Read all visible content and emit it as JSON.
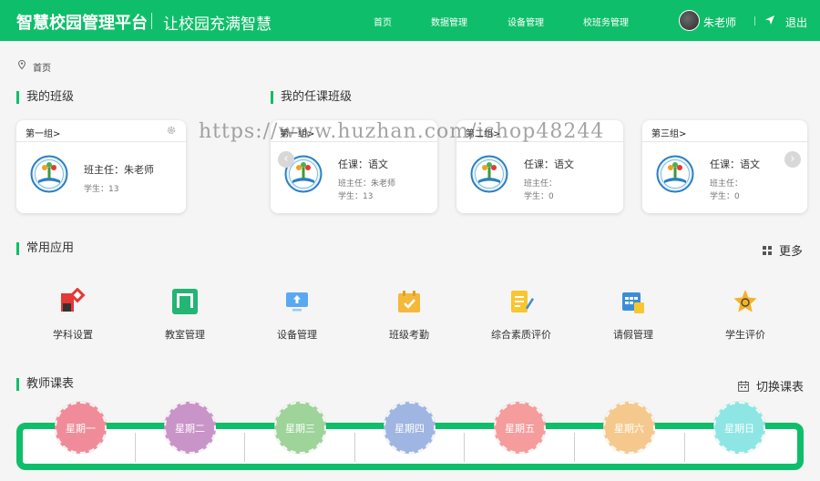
{
  "header": {
    "title": "智慧校园管理平台",
    "subtitle": "让校园充满智慧",
    "nav": [
      "首页",
      "数据管理",
      "设备管理",
      "校班务管理"
    ],
    "user": "朱老师",
    "logout": "退出"
  },
  "breadcrumb": {
    "home": "首页"
  },
  "my_class": {
    "title": "我的班级",
    "card": {
      "group": "第一组>",
      "teacher": "班主任：朱老师",
      "students": "学生：13"
    }
  },
  "teach_class": {
    "title": "我的任课班级",
    "cards": [
      {
        "group": "第一组>",
        "course": "任课：语文",
        "teacher": "班主任：朱老师",
        "students": "学生：13"
      },
      {
        "group": "第二组>",
        "course": "任课：语文",
        "teacher": "班主任：",
        "students": "学生：0"
      },
      {
        "group": "第三组>",
        "course": "任课：语文",
        "teacher": "班主任：",
        "students": "学生：0"
      }
    ]
  },
  "apps": {
    "title": "常用应用",
    "more": "更多",
    "items": [
      {
        "label": "学科设置",
        "icon": "subject-icon",
        "color": "#e53935"
      },
      {
        "label": "教室管理",
        "icon": "classroom-icon",
        "color": "#22b573"
      },
      {
        "label": "设备管理",
        "icon": "device-icon",
        "color": "#5aa9f0"
      },
      {
        "label": "班级考勤",
        "icon": "attendance-icon",
        "color": "#f4b93a"
      },
      {
        "label": "综合素质评价",
        "icon": "quality-icon",
        "color": "#f7c631"
      },
      {
        "label": "请假管理",
        "icon": "leave-icon",
        "color": "#3b8ed6"
      },
      {
        "label": "学生评价",
        "icon": "evaluate-icon",
        "color": "#f5b324"
      }
    ]
  },
  "timetable": {
    "title": "教师课表",
    "switch": "切换课表",
    "days": [
      {
        "label": "星期一",
        "color": "#f08c99"
      },
      {
        "label": "星期二",
        "color": "#c994c8"
      },
      {
        "label": "星期三",
        "color": "#9ed39a"
      },
      {
        "label": "星期四",
        "color": "#9fb5e2"
      },
      {
        "label": "星期五",
        "color": "#f59c9c"
      },
      {
        "label": "星期六",
        "color": "#f5c98d"
      },
      {
        "label": "星期日",
        "color": "#8ee6e4"
      }
    ]
  },
  "watermark": "https://www.huzhan.com/ishop48244"
}
